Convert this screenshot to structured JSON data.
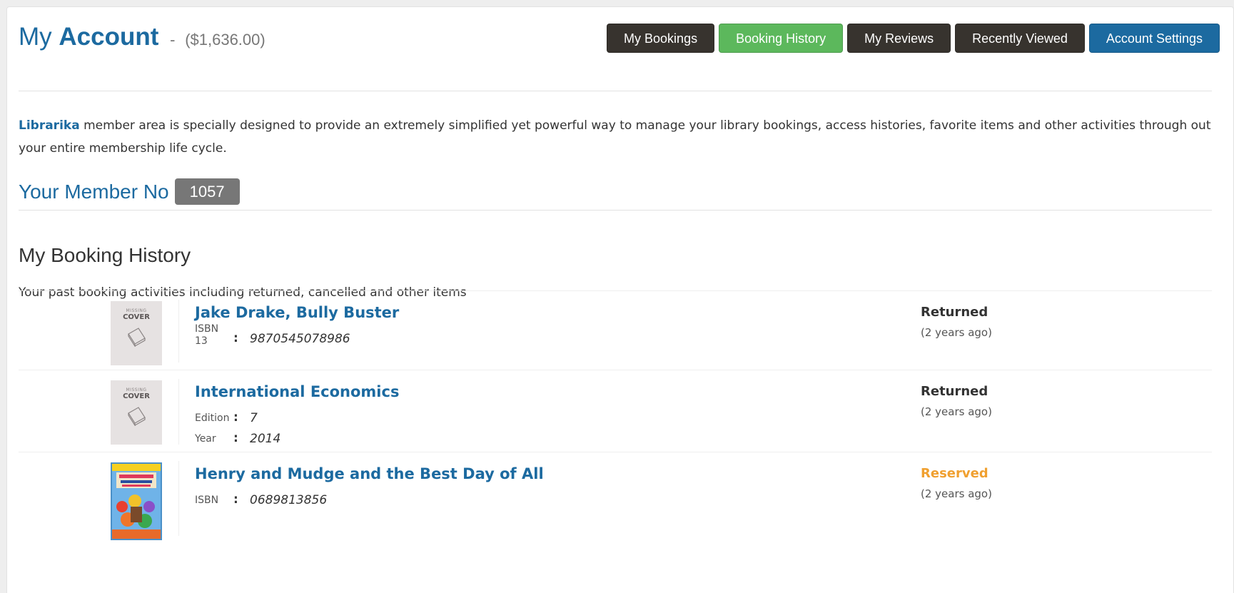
{
  "header": {
    "title_word1": "My",
    "title_word2": "Account",
    "separator": "-",
    "balance": "($1,636.00)"
  },
  "nav": {
    "my_bookings": "My Bookings",
    "booking_history": "Booking History",
    "my_reviews": "My Reviews",
    "recently_viewed": "Recently Viewed",
    "account_settings": "Account Settings"
  },
  "intro": {
    "brand": "Librarika",
    "text": " member area is specially designed to provide an extremely simplified yet powerful way to manage your library bookings, access histories, favorite items and other activities through out your entire membership life cycle."
  },
  "member": {
    "label": "Your Member No",
    "number": "1057"
  },
  "history": {
    "title": "My Booking History",
    "description": "Your past booking activities including returned, cancelled and other items"
  },
  "cover_placeholder": {
    "small": "MISSING",
    "big": "COVER"
  },
  "bookings": [
    {
      "title": "Jake Drake, Bully Buster",
      "meta": [
        {
          "label": "ISBN 13",
          "value": "9870545078986"
        }
      ],
      "status": "Returned",
      "ago": "(2 years ago)"
    },
    {
      "title": "International Economics",
      "meta": [
        {
          "label": "Edition",
          "value": "7"
        },
        {
          "label": "Year",
          "value": "2014"
        }
      ],
      "status": "Returned",
      "ago": "(2 years ago)"
    },
    {
      "title": "Henry and Mudge and the Best Day of All",
      "meta": [
        {
          "label": "ISBN",
          "value": "0689813856"
        }
      ],
      "status": "Reserved",
      "ago": "(2 years ago)"
    }
  ],
  "colors": {
    "primary": "#1c6aa0",
    "dark_button": "#37332e",
    "active_button": "#5cb85c",
    "reserved": "#f0a030",
    "badge": "#777777"
  }
}
